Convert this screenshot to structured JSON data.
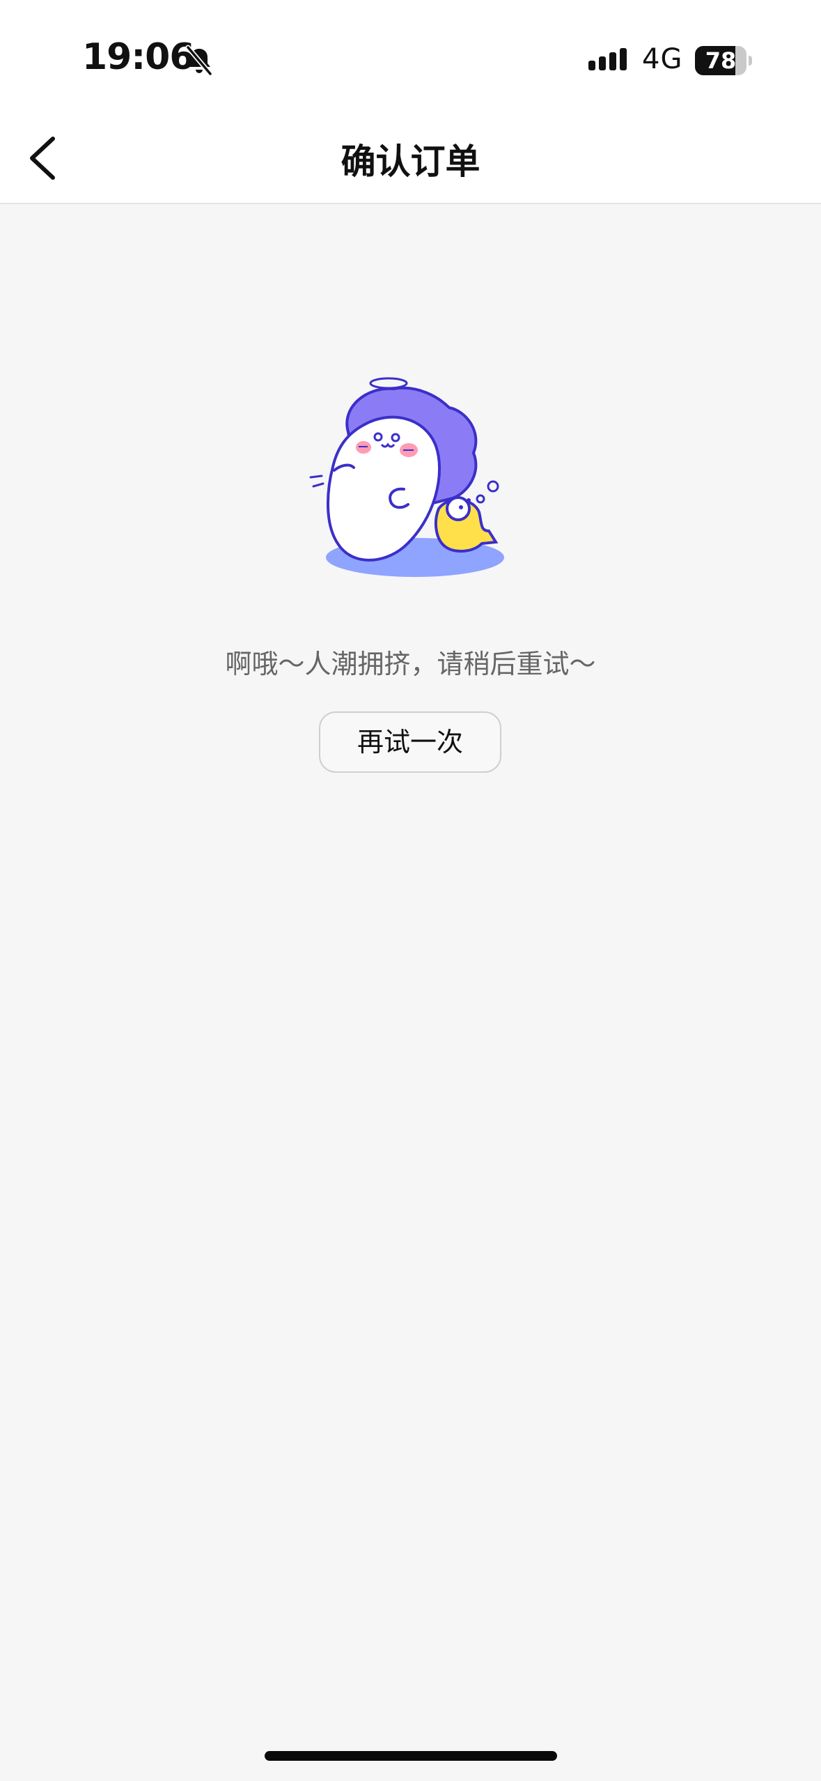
{
  "status_bar": {
    "time": "19:06",
    "network": "4G",
    "battery_level": "78",
    "battery_fraction": 0.78,
    "icons": [
      "bell-slash-icon",
      "signal-icon",
      "battery-icon"
    ]
  },
  "nav": {
    "title": "确认订单",
    "back_icon": "chevron-left-icon"
  },
  "empty_state": {
    "illustration": "seal-mascot-illustration",
    "message": "啊哦～人潮拥挤，请稍后重试～",
    "retry_label": "再试一次"
  },
  "colors": {
    "background": "#f6f6f6",
    "header_background": "#ffffff",
    "mascot_purple": "#8b7cf6",
    "mascot_outline": "#3b2fc9",
    "fish_yellow": "#ffe04a",
    "shadow_blue": "#8fa4ff",
    "message_gray": "#666666"
  }
}
